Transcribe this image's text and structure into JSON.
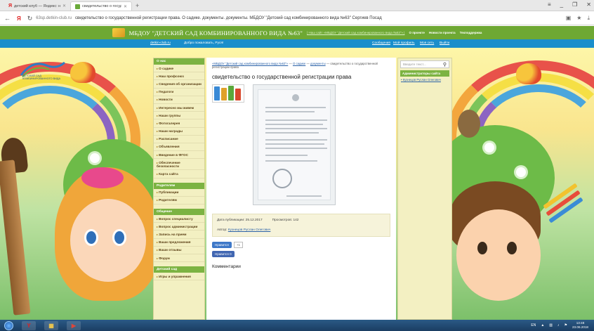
{
  "browser": {
    "tabs": [
      {
        "title": "детский клуб — Яндекс: нашлось…",
        "active": false
      },
      {
        "title": "свидетельство о государ",
        "active": true
      }
    ],
    "new_tab_label": "+",
    "window_controls": [
      "≡",
      "_",
      "❐",
      "✕"
    ],
    "address": {
      "domain": "63sp.detkin-club.ru",
      "title_text": "свидетельство о государственной регистрации права. О садике. документы. документы. МБДОУ \"Детский сад комбинированного вида №63\" Сергиев Посад"
    }
  },
  "site": {
    "name": "МБДОУ \"ДЕТСКИЙ САД КОМБИНИРОВАННОГО ВИДА №63\"",
    "subtitle": "| Наш сайт «МБДОУ \"Детский сад комбинированного вида №63\"» |",
    "top_links": [
      "О проекте",
      "Новости проекта",
      "Техподдержка"
    ],
    "userbar": {
      "site_link": "detkin-club.ru",
      "welcome": "Добро пожаловать, Руся!",
      "links": [
        "Сообщения",
        "Мой профиль",
        "Моя сеть",
        "Выйти"
      ]
    },
    "logo_text": "ДЕТСКИЙ САД КОМБИНИРОВАННОГО ВИДА"
  },
  "left_nav": {
    "sections": [
      {
        "header": "О нас",
        "items": [
          "О садике",
          "Наш профсоюз",
          "Сведения об организации",
          "Педагоги",
          "Новости",
          "Интересно мы живем",
          "Наши группы",
          "Фотогалерея",
          "Наши награды",
          "Расписание",
          "Объявления",
          "Введение в ФГОС",
          "Обеспечение безопасности",
          "Карта сайта"
        ]
      },
      {
        "header": "Родителям",
        "items": [
          "Публикации",
          "Родителям"
        ]
      },
      {
        "header": "Общение",
        "items": [
          "Вопрос специалисту",
          "Вопрос администрации",
          "Запись на прием",
          "Ваши предложения",
          "Ваши отзывы",
          "Форум"
        ]
      },
      {
        "header": "Детский сад",
        "items": [
          "Игры и упражнения"
        ]
      }
    ]
  },
  "main": {
    "breadcrumb": {
      "home": "«МБДОУ \"Детский сад комбинированного вида №63\"»",
      "sep1": " — ",
      "about": "О садике",
      "sep2": " — ",
      "docs": "документы",
      "tail": " — свидетельство о государственной регистрации права"
    },
    "title": "свидетельство о государственной регистрации права",
    "meta": {
      "published_label": "Дата публикации: 25.12.2017",
      "views_label": "Просмотров: 142",
      "author_label": "Автор:",
      "author_name": "Кузнецов Руслан Олегович"
    },
    "share": {
      "like_label": "Нравится",
      "count": "+1",
      "fb_label": "Нравится 0"
    },
    "comments_title": "Комментарии"
  },
  "right_col": {
    "search_placeholder": "Введите текст...",
    "admin_header": "Администраторы сайта",
    "admin_name": "Кузнецов Руслан Олегович"
  },
  "taskbar": {
    "apps": [
      "Y",
      "▦",
      "▶"
    ],
    "tray_lang": "EN",
    "time": "13:48",
    "date": "23.06.2018"
  },
  "colors": {
    "site_green": "#6ea833",
    "user_blue": "#1a8ecb",
    "nav_bg": "#f3f0c2",
    "link": "#2b62a8"
  }
}
